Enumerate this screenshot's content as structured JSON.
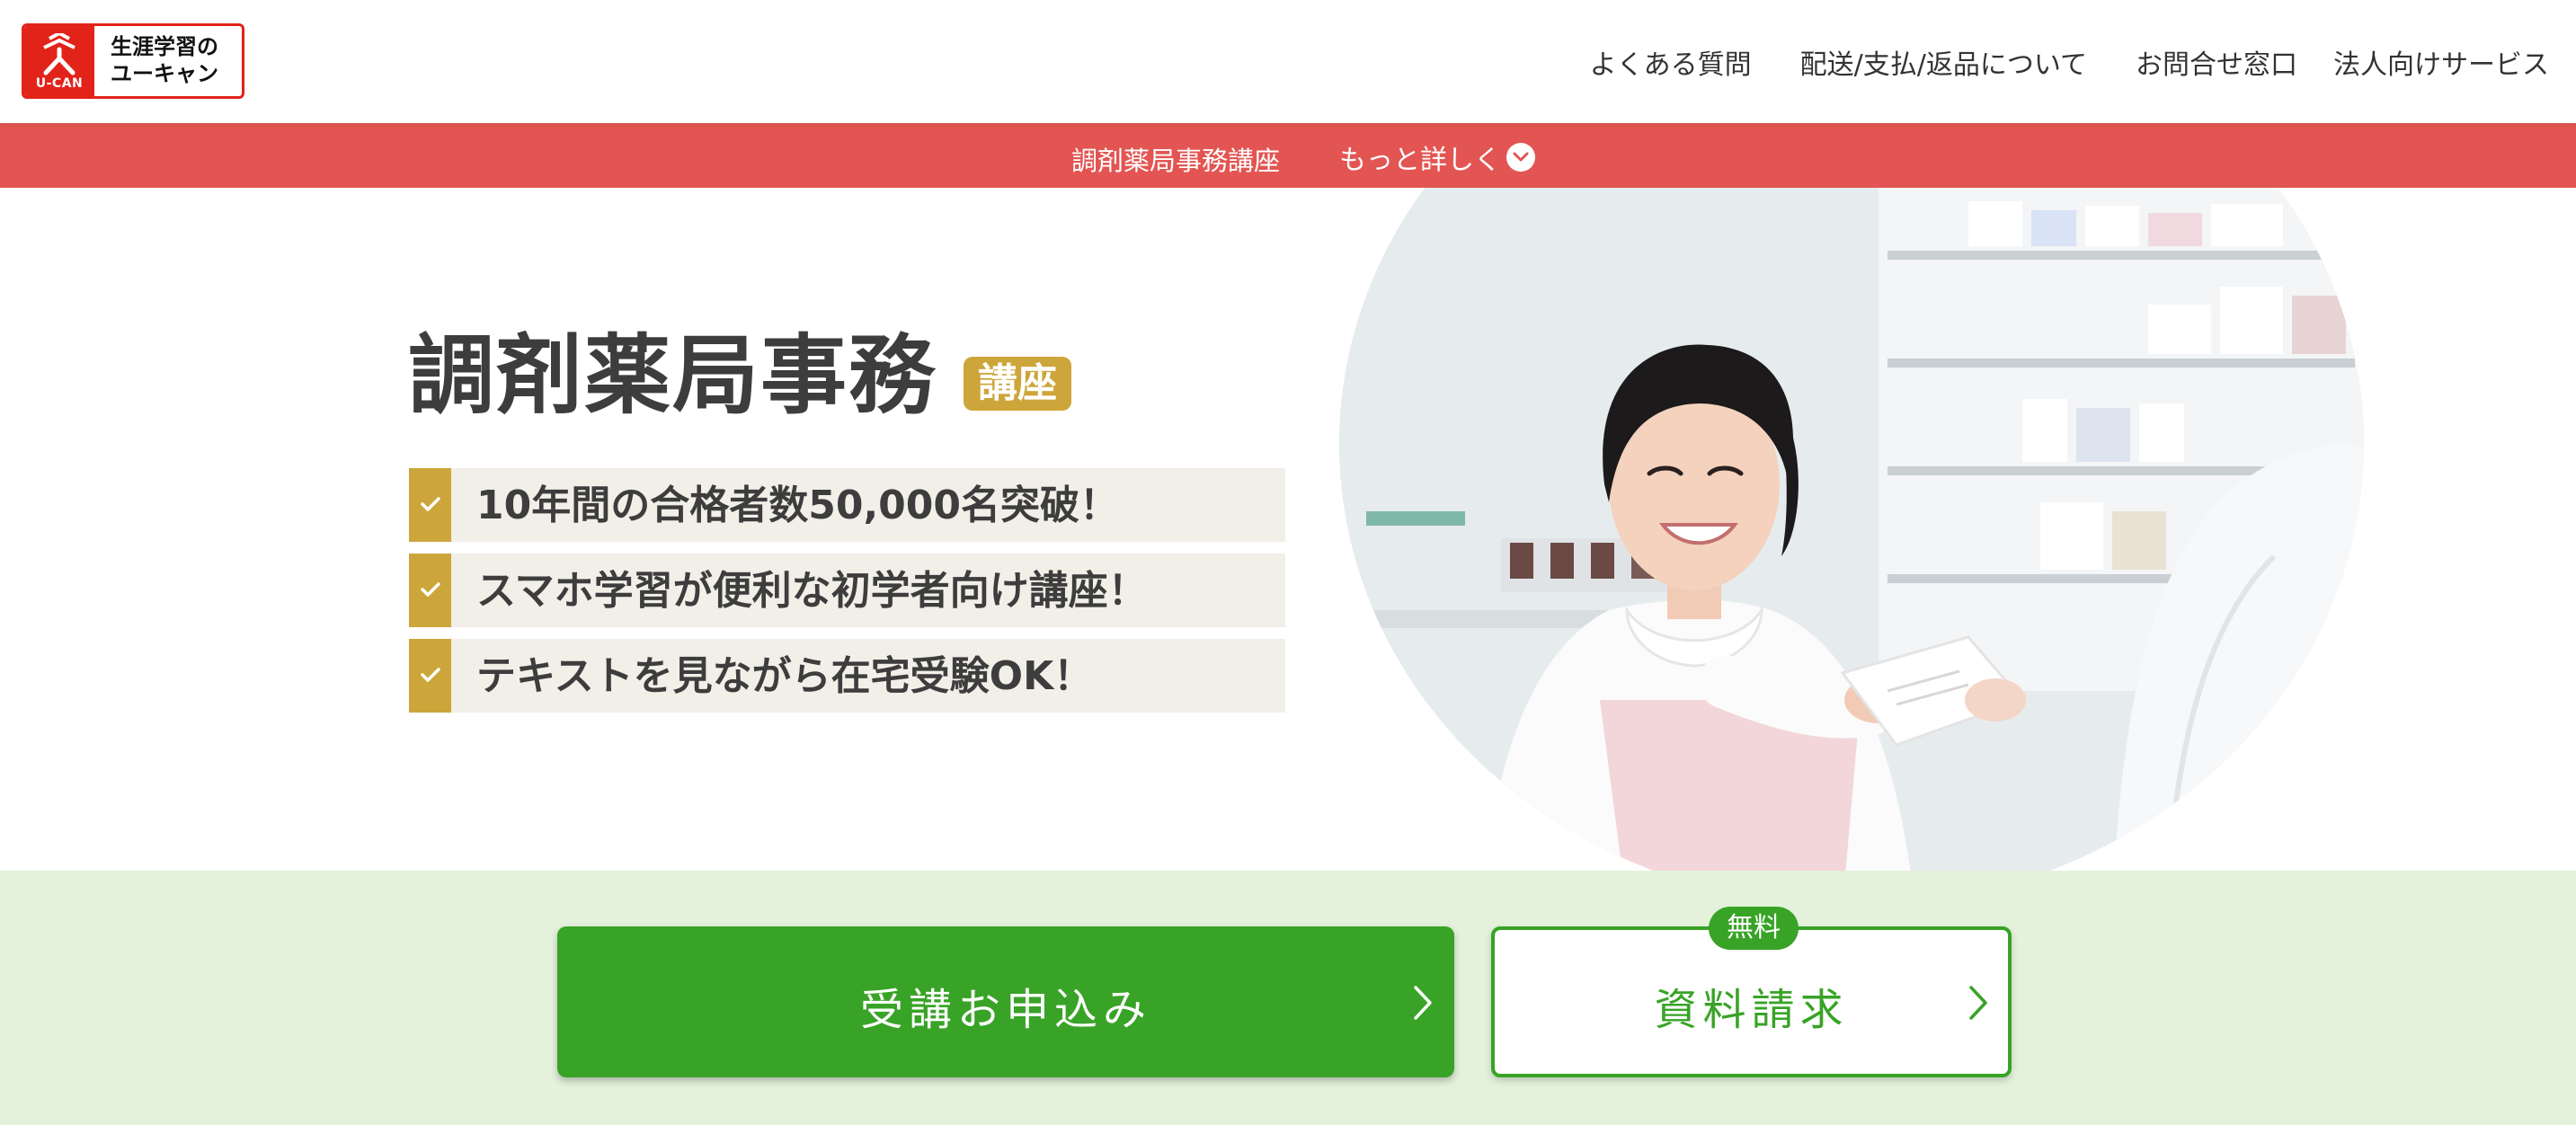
{
  "header": {
    "logo": {
      "mark_text": "U-CAN",
      "brand_line1": "生涯学習の",
      "brand_line2": "ユーキャン"
    },
    "nav": [
      {
        "label": "よくある質問"
      },
      {
        "label": "配送/支払/返品について"
      },
      {
        "label": "お問合せ窓口"
      },
      {
        "label": "法人向けサービス"
      }
    ]
  },
  "subbar": {
    "title": "調剤薬局事務講座",
    "more_label": "もっと詳しく",
    "more_icon": "chevron-down-icon"
  },
  "hero": {
    "title": "調剤薬局事務",
    "badge": "講座",
    "points": [
      {
        "text": "10年間の合格者数50,000名突破！"
      },
      {
        "text": "スマホ学習が便利な初学者向け講座！"
      },
      {
        "text": "テキストを見ながら在宅受験OK！"
      }
    ]
  },
  "cta": {
    "apply_label": "受講お申込み",
    "request_label": "資料請求",
    "free_badge": "無料"
  },
  "colors": {
    "brand_red": "#e2231a",
    "subbar_red": "#e35552",
    "gold": "#cda63b",
    "green": "#38a326",
    "cta_band": "#e4f2dc"
  }
}
